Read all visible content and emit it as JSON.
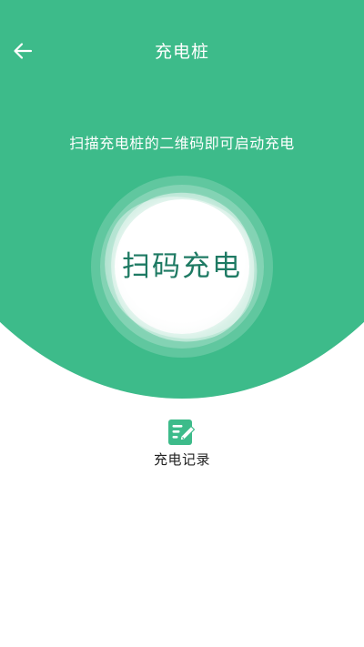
{
  "header": {
    "title": "充电桩",
    "back_icon": "arrow-left-icon"
  },
  "hero": {
    "instruction": "扫描充电桩的二维码即可启动充电",
    "scan_button_label": "扫码充电",
    "background_color": "#3dbb8a",
    "label_color": "#1e7a63"
  },
  "records": {
    "label": "充电记录",
    "icon": "notepad-edit-icon",
    "icon_color": "#3dbb8a"
  }
}
